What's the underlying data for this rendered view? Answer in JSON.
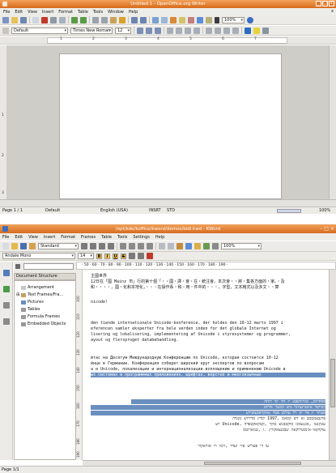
{
  "writer": {
    "title": "Untitled 1 - OpenOffice.org Writer",
    "menu": [
      "File",
      "Edit",
      "View",
      "Insert",
      "Format",
      "Table",
      "Tools",
      "Window",
      "Help"
    ],
    "close_glyph": "x",
    "para_style": "Default",
    "font_name": "Times New Roman",
    "font_size": "12",
    "zoom": "100%",
    "ruler_numbers": [
      "1",
      "2",
      "3",
      "4",
      "5",
      "6",
      "7"
    ],
    "vruler_numbers": [
      "1",
      "2",
      "3"
    ],
    "status": {
      "page": "Page 1 / 1",
      "style": "Default",
      "language": "English (USA)",
      "mode1": "INSRT",
      "mode2": "STD",
      "zoom": "100%"
    }
  },
  "kword": {
    "title": "/opt/kde/koffice/kword/demos/bidi.kwd - KWord",
    "menu": [
      "File",
      "Edit",
      "View",
      "Insert",
      "Format",
      "Frames",
      "Table",
      "Tools",
      "Settings",
      "Help"
    ],
    "style": "Standard",
    "font_name": "Andale Mono",
    "font_size": "14",
    "zoom": "100%",
    "format_buttons": [
      "B",
      "I",
      "U",
      "S"
    ],
    "hruler": "· 50 · 60 · 70 · 80 · 90 · 100 · 110 · 120 · 130 · 140 · 150 · 160 · 170 · 180 · 190 ·",
    "vruler_numbers": [
      "100",
      "110",
      "120",
      "130",
      "140",
      "150",
      "160",
      "170",
      "180",
      "190"
    ],
    "panel_title": "Document Structure",
    "tree": [
      "Arrangement",
      "Text Frames/Fra...",
      "Pictures",
      "Tables",
      "Formula Frames",
      "Embedded Objects"
    ],
    "doc_lines": [
      "主國世界",
      "12日在「國 Mainz 市」行的第十個「‧‧國‧譯‧會‧在‧統注會。本次會‧‧將‧集各方面的‧家。‧及",
      "和‧‧‧‧，國‧化和本地化，‧‧‧在操作系‧和‧用‧件中的‧‧‧，字型，文本格式以及多文‧‧算",
      "nicode！",
      "",
      "den tiende internationale Unicode-konference, der holdes den 10-12 marts 1997 i",
      "eferencen samler eksperter fra hele verden inden for det globale Internet og",
      "lisering og lokalisering, implementering af Unicode i styresystemer og programmer,",
      "ayout og flersproget databehandling.",
      "",
      "йтас на Десятум Международную Конференцию по Unicode, которая состоится 10-12",
      "йнце в Германии. Конференция соберет широкий круг экспертов по  вопросам",
      "а и Unicode, локализации и интернационализации.воплощению и применению Unicode в",
      "ых системах и программных приложениях, шрифтах, верстке и многоязычных"
    ],
    "rtl_lines": [
      "פסחרנק, סגויזוקפטג יז חד ינד דוחה",
      "קוניקוד אינטרנציונל ביט קונטר נוליוט",
      "סעתר יז אוי יזן רל עולום פסד גאוקויאטצשירע",
      "פרגבצמטסב זא דש קסאמ ,1997 קודץ סדירוש נקגדה",
      "עטץנטו ,סגגגצמגז סוקאבגוצ בוקר ,קטקאקטפדה ,Unicode רע",
      "עוקוקאז-אינסטרוקאה שבבנצאקורץ .ו ,טנוארוטס"
    ],
    "rtl_footer": "עו די פעליש פיר ועדד ,ויכוו רו אוזיאקור",
    "status": "Page 1/1"
  }
}
